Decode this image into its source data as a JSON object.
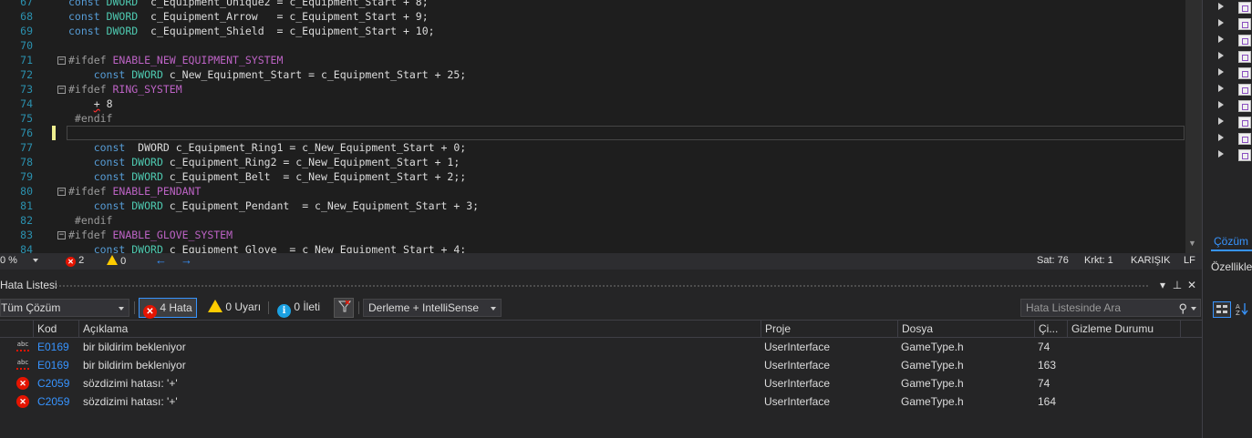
{
  "editor": {
    "lines": [
      {
        "num": "67",
        "tokens": [
          [
            "kw",
            "const "
          ],
          [
            "ty",
            "DWORD"
          ],
          [
            "",
            "  c_Equipment_Unique2 = c_Equipment_Start + 8;"
          ]
        ]
      },
      {
        "num": "68",
        "tokens": [
          [
            "kw",
            "const "
          ],
          [
            "ty",
            "DWORD"
          ],
          [
            "",
            "  c_Equipment_Arrow   = c_Equipment_Start + 9;"
          ]
        ]
      },
      {
        "num": "69",
        "tokens": [
          [
            "kw",
            "const "
          ],
          [
            "ty",
            "DWORD"
          ],
          [
            "",
            "  c_Equipment_Shield  = c_Equipment_Start + 10;"
          ]
        ]
      },
      {
        "num": "70",
        "tokens": []
      },
      {
        "num": "71",
        "fold": true,
        "tokens": [
          [
            "pp",
            "#ifdef "
          ],
          [
            "mc",
            "ENABLE_NEW_EQUIPMENT_SYSTEM"
          ]
        ]
      },
      {
        "num": "72",
        "tokens": [
          [
            "",
            "    "
          ],
          [
            "kw",
            "const "
          ],
          [
            "ty",
            "DWORD"
          ],
          [
            "",
            " c_New_Equipment_Start = c_Equipment_Start + 25;"
          ]
        ]
      },
      {
        "num": "73",
        "fold": true,
        "tokens": [
          [
            "pp",
            "#ifdef "
          ],
          [
            "mc",
            "RING_SYSTEM"
          ]
        ]
      },
      {
        "num": "74",
        "tokens": [
          [
            "",
            "    "
          ],
          [
            "err",
            "+"
          ],
          [
            "",
            " 8"
          ]
        ]
      },
      {
        "num": "75",
        "tokens": [
          [
            "pp",
            " #endif"
          ]
        ]
      },
      {
        "num": "76",
        "tokens": []
      },
      {
        "num": "77",
        "tokens": [
          [
            "",
            "    "
          ],
          [
            "kw",
            "const "
          ],
          [
            "",
            " DWORD c_Equipment_Ring1 = c_New_Equipment_Start + 0;"
          ]
        ]
      },
      {
        "num": "78",
        "tokens": [
          [
            "",
            "    "
          ],
          [
            "kw",
            "const "
          ],
          [
            "ty",
            "DWORD"
          ],
          [
            "",
            " c_Equipment_Ring2 = c_New_Equipment_Start + 1;"
          ]
        ]
      },
      {
        "num": "79",
        "tokens": [
          [
            "",
            "    "
          ],
          [
            "kw",
            "const "
          ],
          [
            "ty",
            "DWORD"
          ],
          [
            "",
            " c_Equipment_Belt  = c_New_Equipment_Start + 2;;"
          ]
        ]
      },
      {
        "num": "80",
        "fold": true,
        "tokens": [
          [
            "pp",
            "#ifdef "
          ],
          [
            "mc",
            "ENABLE_PENDANT"
          ]
        ]
      },
      {
        "num": "81",
        "tokens": [
          [
            "",
            "    "
          ],
          [
            "kw",
            "const "
          ],
          [
            "ty",
            "DWORD"
          ],
          [
            "",
            " c_Equipment_Pendant  = c_New_Equipment_Start + 3;"
          ]
        ]
      },
      {
        "num": "82",
        "tokens": [
          [
            "pp",
            " #endif"
          ]
        ]
      },
      {
        "num": "83",
        "fold": true,
        "tokens": [
          [
            "pp",
            "#ifdef "
          ],
          [
            "mc",
            "ENABLE_GLOVE_SYSTEM"
          ]
        ]
      },
      {
        "num": "84",
        "tokens": [
          [
            "",
            "    "
          ],
          [
            "kw",
            "const "
          ],
          [
            "ty",
            "DWORD"
          ],
          [
            "",
            " c_Equipment_Glove  = c_New_Equipment_Start + 4;"
          ]
        ]
      }
    ]
  },
  "status": {
    "zoom": "0 %",
    "errors": "2",
    "warnings": "0",
    "line": "Sat: 76",
    "col": "Krkt: 1",
    "mode": "KARIŞIK",
    "eol": "LF"
  },
  "right_panel": {
    "solution_tab": "Çözüm",
    "properties_title": "Özellikle"
  },
  "error_list": {
    "title": "Hata Listesi",
    "scope": "Tüm Çözüm",
    "errors_label": "4 Hata",
    "warnings_label": "0 Uyarı",
    "messages_label": "0 İleti",
    "build_filter": "Derleme + IntelliSense",
    "search_placeholder": "Hata Listesinde Ara",
    "columns": [
      "Kod",
      "Açıklama",
      "Proje",
      "Dosya",
      "Çi...",
      "Gizleme Durumu"
    ],
    "rows": [
      {
        "icon": "intellisense-error-icon",
        "code": "E0169",
        "desc": "bir bildirim bekleniyor",
        "project": "UserInterface",
        "file": "GameType.h",
        "line": "74"
      },
      {
        "icon": "intellisense-error-icon",
        "code": "E0169",
        "desc": "bir bildirim bekleniyor",
        "project": "UserInterface",
        "file": "GameType.h",
        "line": "163"
      },
      {
        "icon": "build-error-icon",
        "code": "C2059",
        "desc": "sözdizimi hatası: '+'",
        "project": "UserInterface",
        "file": "GameType.h",
        "line": "74"
      },
      {
        "icon": "build-error-icon",
        "code": "C2059",
        "desc": "sözdizimi hatası: '+'",
        "project": "UserInterface",
        "file": "GameType.h",
        "line": "164"
      }
    ]
  },
  "colors": {
    "keyword": "#569cd6",
    "type": "#4ec9b0",
    "macro": "#bd63c5",
    "line_number": "#2b91af",
    "link": "#3794ff",
    "error": "#e51400"
  }
}
